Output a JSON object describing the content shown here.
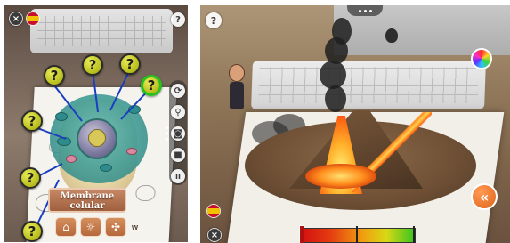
{
  "left_view": {
    "hotspots": [
      "?",
      "?",
      "?",
      "?",
      "?",
      "?",
      "?"
    ],
    "label": {
      "line1": "Membrane",
      "line2": "celular"
    },
    "toolbar": {
      "close": "×",
      "help": "?",
      "rotate": "⟳",
      "zoom": "⚲",
      "camera": "◙",
      "video": "■",
      "pause": "II"
    },
    "bottom_icons": [
      "⌂",
      "☼",
      "✣"
    ],
    "brand": "w"
  },
  "right_view": {
    "help": "?",
    "close": "×",
    "back": "«",
    "heat_level": 0.02
  },
  "colors": {
    "hotspot_yellow": "#c6cb22",
    "hotspot_active_ring": "#27c21f",
    "label_brown": "#a0603f",
    "back_orange": "#e06318"
  }
}
